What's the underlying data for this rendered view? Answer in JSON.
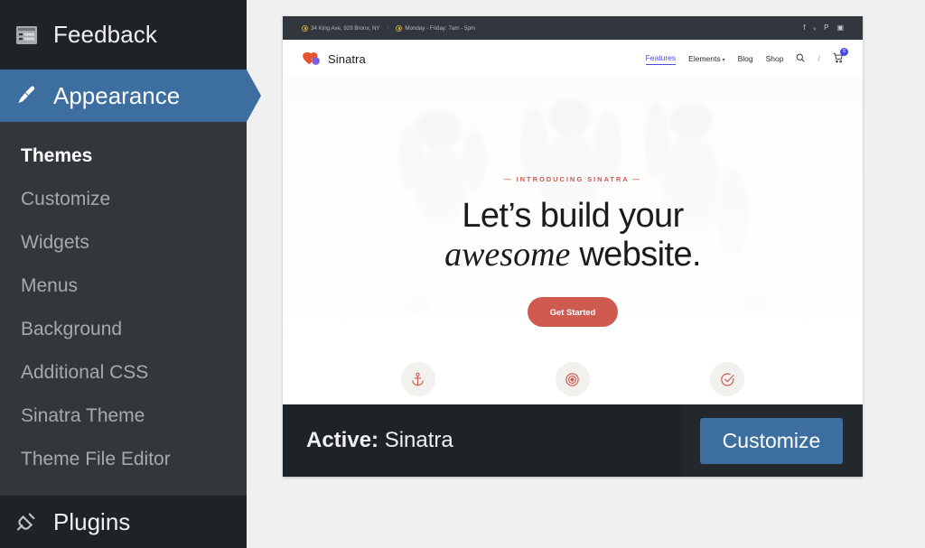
{
  "sidebar": {
    "top_item": {
      "label": "Feedback",
      "icon": "feedback-form-icon"
    },
    "active_item": {
      "label": "Appearance",
      "icon": "paintbrush-icon"
    },
    "submenu": [
      {
        "label": "Themes",
        "current": true
      },
      {
        "label": "Customize",
        "current": false
      },
      {
        "label": "Widgets",
        "current": false
      },
      {
        "label": "Menus",
        "current": false
      },
      {
        "label": "Background",
        "current": false
      },
      {
        "label": "Additional CSS",
        "current": false
      },
      {
        "label": "Sinatra Theme",
        "current": false
      },
      {
        "label": "Theme File Editor",
        "current": false
      }
    ],
    "bottom_item": {
      "label": "Plugins",
      "icon": "plug-icon"
    }
  },
  "theme_card": {
    "active_label": "Active:",
    "theme_name": "Sinatra",
    "customize_button": "Customize"
  },
  "preview": {
    "topbar": {
      "address": "34 King Ave, 929 Bronx, NY",
      "separator": "/",
      "hours": "Monday - Friday: 7am - 5pm",
      "socials": [
        {
          "name": "facebook-icon",
          "glyph": "f"
        },
        {
          "name": "twitter-icon",
          "glyph": "ᵥ"
        },
        {
          "name": "pinterest-icon",
          "glyph": "P"
        },
        {
          "name": "instagram-icon",
          "glyph": "▣"
        }
      ]
    },
    "brand": {
      "name": "Sinatra",
      "mark": "sinatra-logo-icon"
    },
    "nav": {
      "items": [
        {
          "label": "Features",
          "active": true,
          "caret": false
        },
        {
          "label": "Elements",
          "active": false,
          "caret": true
        },
        {
          "label": "Blog",
          "active": false,
          "caret": false
        },
        {
          "label": "Shop",
          "active": false,
          "caret": false
        }
      ],
      "search_icon": "search-icon",
      "divider": "/",
      "cart_icon": "cart-icon",
      "cart_count": "0"
    },
    "hero": {
      "eyebrow": "— INTRODUCING SINATRA —",
      "title_line1": "Let’s build your",
      "title_em": "awesome",
      "title_rest": " website.",
      "cta": "Get Started"
    },
    "features": [
      {
        "icon": "anchor-icon"
      },
      {
        "icon": "target-icon"
      },
      {
        "icon": "check-circle-icon"
      }
    ]
  },
  "colors": {
    "admin_dark": "#1d2327",
    "admin_body": "#2c3338",
    "submenu_bg": "#32373c",
    "wp_blue": "#3c6e9f",
    "accent_coral": "#cf5b50",
    "nav_indigo": "#4a4ae0",
    "topbar_gold": "#c8a243",
    "page_bg": "#f0f0f1"
  }
}
